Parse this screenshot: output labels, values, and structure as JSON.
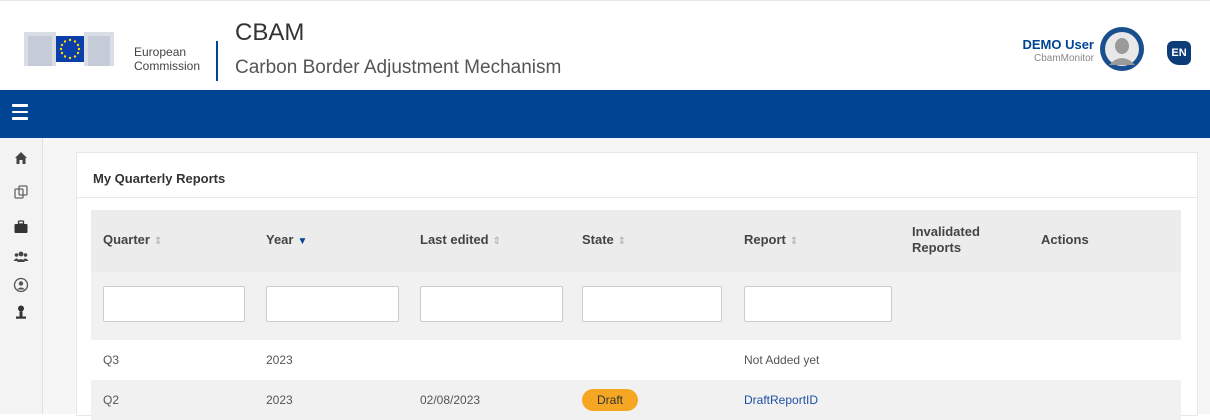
{
  "header": {
    "org_line1": "European",
    "org_line2": "Commission",
    "app_title": "CBAM",
    "app_subtitle": "Carbon Border Adjustment Mechanism",
    "user_name": "DEMO User",
    "user_role": "CbamMonitor",
    "language": "EN"
  },
  "sidebar": {
    "items": [
      {
        "icon": "home-icon"
      },
      {
        "icon": "reports-icon"
      },
      {
        "icon": "briefcase-icon"
      },
      {
        "icon": "users-icon"
      },
      {
        "icon": "user-circle-icon"
      },
      {
        "icon": "user-icon"
      }
    ]
  },
  "panel": {
    "title": "My Quarterly Reports"
  },
  "table": {
    "columns": [
      {
        "label": "Quarter",
        "sort": "both"
      },
      {
        "label": "Year",
        "sort": "desc"
      },
      {
        "label": "Last edited",
        "sort": "both"
      },
      {
        "label": "State",
        "sort": "both"
      },
      {
        "label": "Report",
        "sort": "both"
      },
      {
        "label": "Invalidated Reports",
        "sort": "none"
      },
      {
        "label": "Actions",
        "sort": "none"
      }
    ],
    "rows": [
      {
        "quarter": "Q3",
        "year": "2023",
        "last_edited": "",
        "state": "",
        "report": "Not Added yet"
      },
      {
        "quarter": "Q2",
        "year": "2023",
        "last_edited": "02/08/2023",
        "state": "Draft",
        "report": "DraftReportID"
      }
    ]
  },
  "colors": {
    "primary": "#004494",
    "badge_draft": "#f5a623",
    "link": "#1f4fa3"
  }
}
